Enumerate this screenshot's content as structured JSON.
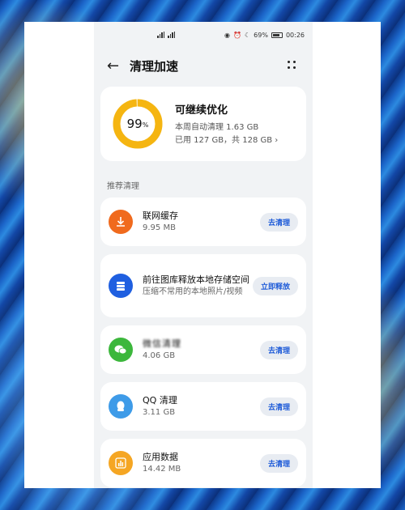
{
  "statusbar": {
    "right_text": "69%",
    "time": "00:26"
  },
  "header": {
    "title": "清理加速"
  },
  "summary": {
    "percent": "99",
    "percent_sign": "%",
    "title": "可继续优化",
    "line1": "本周自动清理 1.63 GB",
    "line2": "已用 127 GB，共 128 GB",
    "used_fraction": 0.99,
    "ring_color": "#F5B511"
  },
  "section": {
    "label": "推荐清理"
  },
  "items": [
    {
      "title": "联网缓存",
      "sub": "9.95 MB",
      "button": "去清理",
      "icon": "download-icon",
      "color": "#F06A1D"
    },
    {
      "title": "前往图库释放本地存储空间",
      "sub": "压缩不常用的本地照片/视频",
      "button": "立即释放",
      "icon": "storage-icon",
      "color": "#1F5FE0"
    },
    {
      "title": "微信清理",
      "sub": "4.06 GB",
      "button": "去清理",
      "icon": "wechat-icon",
      "color": "#3CB73C"
    },
    {
      "title": "QQ 清理",
      "sub": "3.11 GB",
      "button": "去清理",
      "icon": "qq-icon",
      "color": "#3E9BE8"
    },
    {
      "title": "应用数据",
      "sub": "14.42 MB",
      "button": "去清理",
      "icon": "app-data-icon",
      "color": "#F5A623"
    }
  ]
}
